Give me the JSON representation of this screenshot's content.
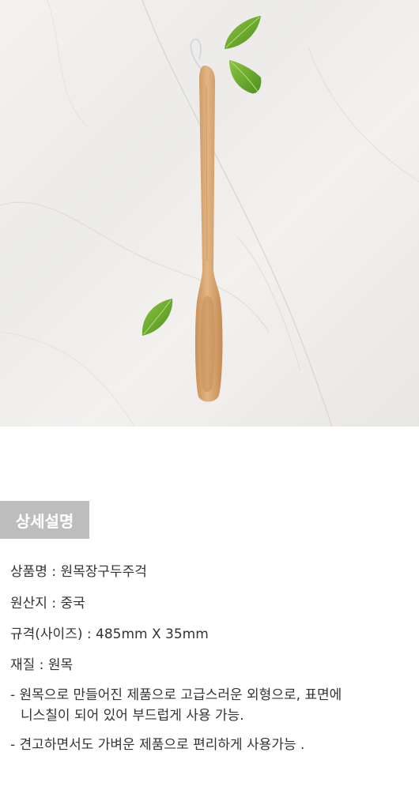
{
  "section": {
    "badge_label": "상세설명"
  },
  "details": {
    "product_name": "상품명 : 원목장구두주걱",
    "origin": "원산지 : 중국",
    "size": "규격(사이즈) : 485mm X 35mm",
    "material": "재질 : 원목"
  },
  "notes": {
    "note1_line1": "- 원목으로 만들어진 제품으로 고급스러운 외형으로, 표면에",
    "note1_line2": "니스칠이 되어 있어 부드럽게 사용 가능.",
    "note2": "- 견고하면서도 가벼운 제품으로 편리하게 사용가능 ."
  },
  "colors": {
    "badge_bg": "#bdbdbd",
    "text": "#333333",
    "wood": "#d9a66f",
    "leaf": "#6fae2e"
  }
}
